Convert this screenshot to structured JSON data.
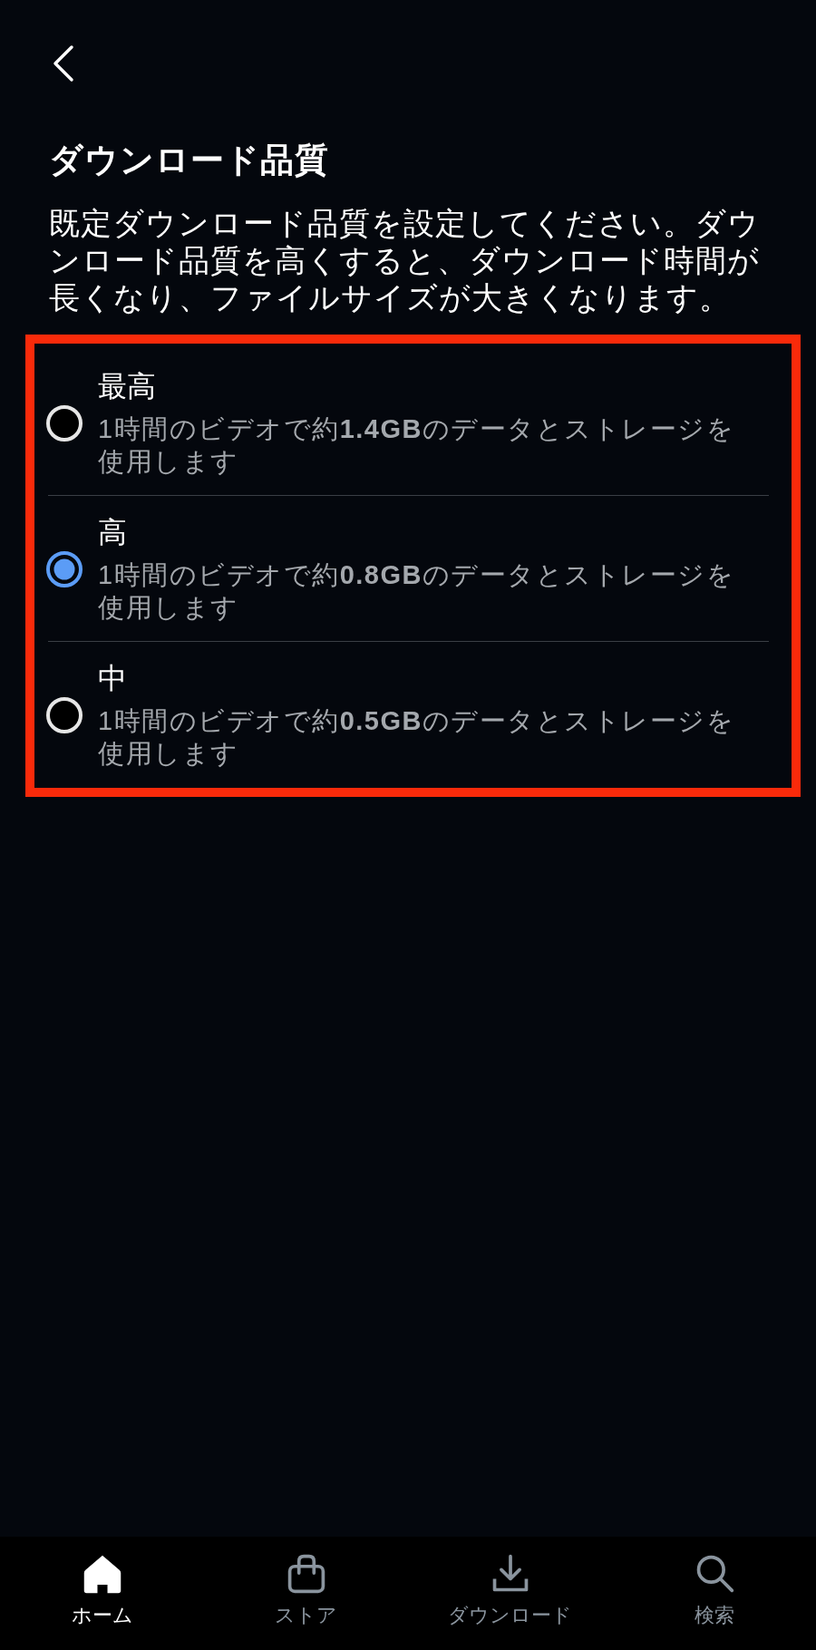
{
  "title": "ダウンロード品質",
  "description": "既定ダウンロード品質を設定してください。ダウンロード品質を高くすると、ダウンロード時間が長くなり、ファイルサイズが大きくなります。",
  "options": [
    {
      "label": "最高",
      "detail": "1時間のビデオで約**1.4GB**のデータとストレージを使用します",
      "selected": false
    },
    {
      "label": "高",
      "detail": "1時間のビデオで約**0.8GB**のデータとストレージを使用します",
      "selected": true
    },
    {
      "label": "中",
      "detail": "1時間のビデオで約**0.5GB**のデータとストレージを使用します",
      "selected": false
    }
  ],
  "tab_bar": [
    {
      "label": "ホーム",
      "selected": true
    },
    {
      "label": "ストア",
      "selected": false
    },
    {
      "label": "ダウンロード",
      "selected": false
    },
    {
      "label": "検索",
      "selected": false
    }
  ]
}
